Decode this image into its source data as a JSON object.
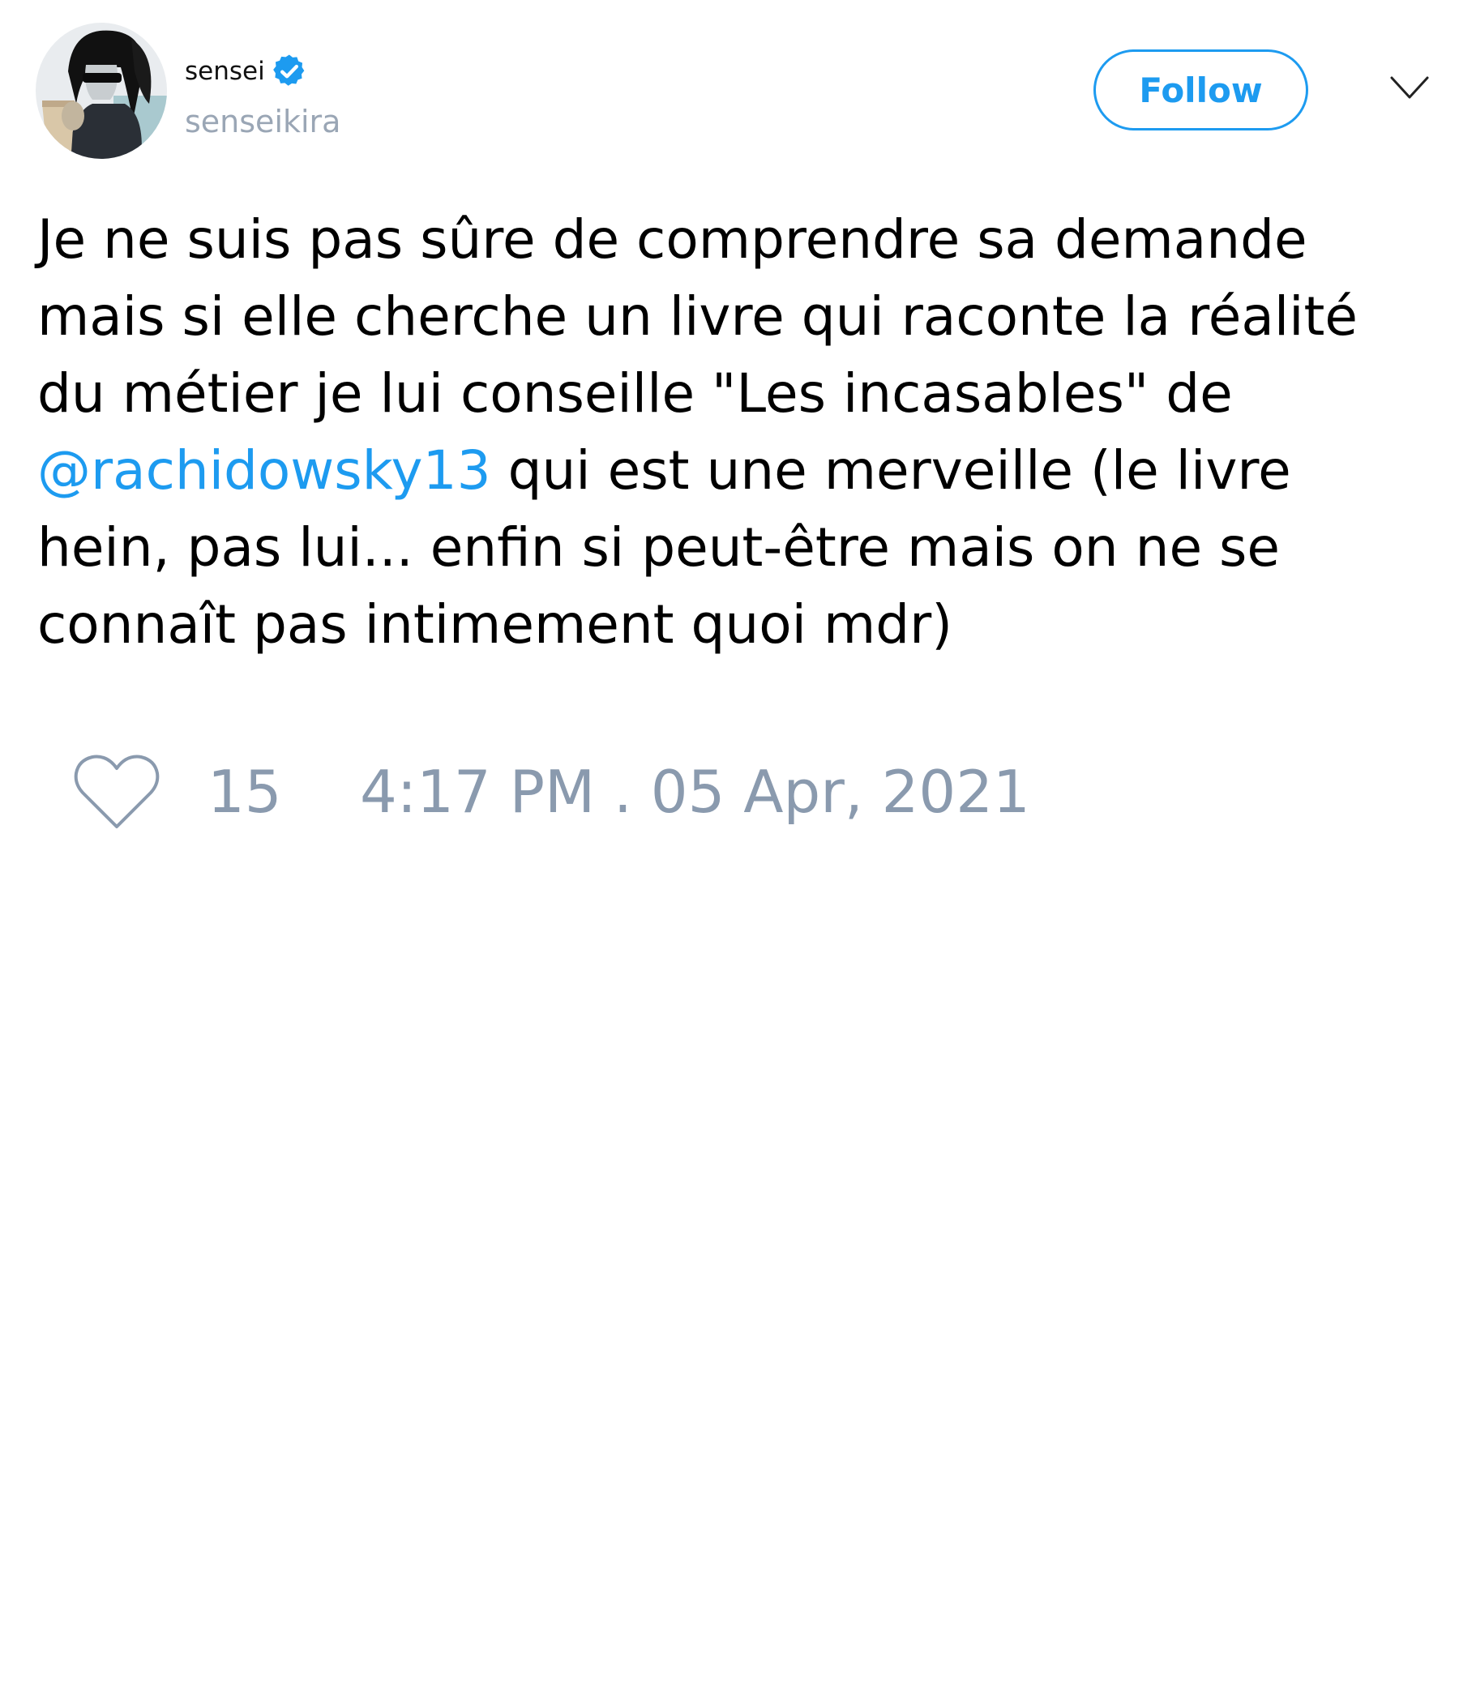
{
  "author": {
    "display_name": "sensei",
    "handle": "senseikira",
    "verified": true,
    "verified_icon": "verified-badge-icon",
    "verified_color": "#1d9bf0"
  },
  "actions": {
    "follow_label": "Follow",
    "menu_icon": "chevron-down-icon",
    "accent_color": "#1d9bf0"
  },
  "tweet": {
    "line_1": "Je ne suis pas sûre de comprendre sa demande",
    "line_2": "mais si elle cherche un livre qui raconte la réalité",
    "line_3": "du métier je lui conseille \"Les incasables\" de",
    "mention": "@rachidowsky13",
    "line_4_rest": " qui est une merveille (le livre",
    "line_5": "hein, pas lui... enfin si peut-être mais on ne se",
    "line_6": "connaît pas intimement quoi mdr)"
  },
  "footer": {
    "like_icon": "heart-icon",
    "like_count": "15",
    "timestamp": "4:17 PM . 05 Apr, 2021"
  }
}
